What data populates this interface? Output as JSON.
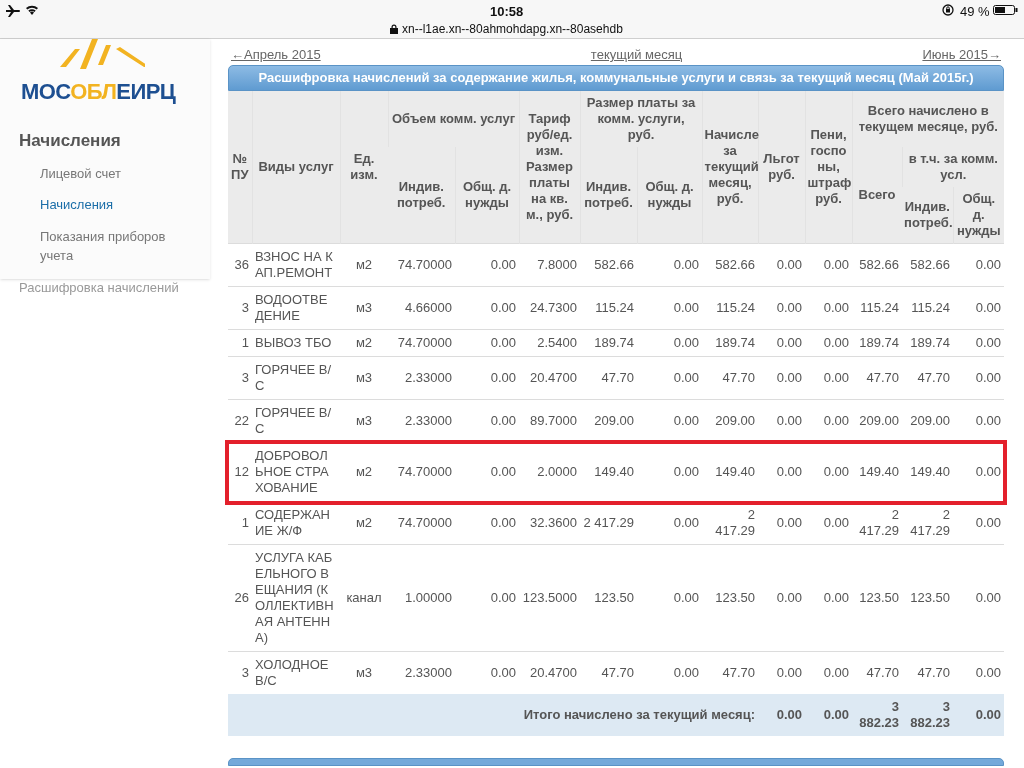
{
  "status_bar": {
    "time": "10:58",
    "url": "xn--l1ae.xn--80ahmohdapg.xn--80asehdb",
    "battery": "49 %"
  },
  "logo": {
    "parts": [
      {
        "text": "МОС",
        "color": "#1d4f91"
      },
      {
        "text": "ОБЛ",
        "color": "#f2b321"
      },
      {
        "text": "ЕИРЦ",
        "color": "#1d4f91"
      }
    ]
  },
  "sidebar": {
    "heading": "Начисления",
    "items": [
      {
        "label": "Лицевой счет",
        "selected": false
      },
      {
        "label": "Начисления",
        "selected": true
      },
      {
        "label": "Показания приборов учета",
        "selected": false
      }
    ],
    "footer_link": "Расшифровка начислений"
  },
  "nav": {
    "prev": "←Апрель 2015",
    "current": "текущий месяц",
    "next": "Июнь 2015→"
  },
  "table": {
    "title": "Расшифровка начислений за содержание жилья, коммунальные услуги и связь за текущий месяц (Май 2015г.)",
    "columns": [
      {
        "label": "№ ПУ"
      },
      {
        "label": "Виды услуг"
      },
      {
        "label": "Ед. изм."
      },
      {
        "label": "Объем комм. услуг",
        "colspan": 2,
        "children": [
          {
            "label": "Индив. потреб."
          },
          {
            "label": "Общ. д. нужды"
          }
        ]
      },
      {
        "label": "Тариф руб/ед. изм. Размер платы на кв. м., руб."
      },
      {
        "label": "Размер платы за комм. услуги, руб.",
        "colspan": 2,
        "children": [
          {
            "label": "Индив. потреб."
          },
          {
            "label": "Общ. д. нужды"
          }
        ]
      },
      {
        "label": "Начисле за текущий месяц, руб."
      },
      {
        "label": "Льгот руб."
      },
      {
        "label": "Пени, госпо ны, штраф руб."
      },
      {
        "label": "Всего начислено в текущем месяце, руб.",
        "colspan": 3,
        "children": [
          {
            "label": "Всего"
          },
          {
            "label": "в т.ч. за комм. усл.",
            "colspan": 2,
            "children": [
              {
                "label": "Индив. потреб."
              },
              {
                "label": "Общ. д. нужды"
              }
            ]
          }
        ]
      }
    ],
    "rows": [
      {
        "highlighted": false,
        "cells": [
          "36",
          "ВЗНОС НА КАП.РЕМОНТ",
          "м2",
          "74.70000",
          "0.00",
          "7.8000",
          "582.66",
          "0.00",
          "582.66",
          "0.00",
          "0.00",
          "582.66",
          "582.66",
          "0.00"
        ]
      },
      {
        "highlighted": false,
        "cells": [
          "3",
          "ВОДООТВЕДЕНИЕ",
          "м3",
          "4.66000",
          "0.00",
          "24.7300",
          "115.24",
          "0.00",
          "115.24",
          "0.00",
          "0.00",
          "115.24",
          "115.24",
          "0.00"
        ]
      },
      {
        "highlighted": false,
        "cells": [
          "1",
          "ВЫВОЗ ТБО",
          "м2",
          "74.70000",
          "0.00",
          "2.5400",
          "189.74",
          "0.00",
          "189.74",
          "0.00",
          "0.00",
          "189.74",
          "189.74",
          "0.00"
        ]
      },
      {
        "highlighted": false,
        "cells": [
          "3",
          "ГОРЯЧЕЕ В/С",
          "м3",
          "2.33000",
          "0.00",
          "20.4700",
          "47.70",
          "0.00",
          "47.70",
          "0.00",
          "0.00",
          "47.70",
          "47.70",
          "0.00"
        ]
      },
      {
        "highlighted": false,
        "cells": [
          "22",
          "ГОРЯЧЕЕ В/С",
          "м3",
          "2.33000",
          "0.00",
          "89.7000",
          "209.00",
          "0.00",
          "209.00",
          "0.00",
          "0.00",
          "209.00",
          "209.00",
          "0.00"
        ]
      },
      {
        "highlighted": true,
        "cells": [
          "12",
          "ДОБРОВОЛЬНОЕ СТРАХОВАНИЕ",
          "м2",
          "74.70000",
          "0.00",
          "2.0000",
          "149.40",
          "0.00",
          "149.40",
          "0.00",
          "0.00",
          "149.40",
          "149.40",
          "0.00"
        ]
      },
      {
        "highlighted": false,
        "cells": [
          "1",
          "СОДЕРЖАНИЕ Ж/Ф",
          "м2",
          "74.70000",
          "0.00",
          "32.3600",
          "2 417.29",
          "0.00",
          "2 417.29",
          "0.00",
          "0.00",
          "2 417.29",
          "2 417.29",
          "0.00"
        ]
      },
      {
        "highlighted": false,
        "cells": [
          "26",
          "УСЛУГА КАБЕЛЬНОГО ВЕЩАНИЯ (КОЛЛЕКТИВНАЯ АНТЕННА)",
          "канал",
          "1.00000",
          "0.00",
          "123.5000",
          "123.50",
          "0.00",
          "123.50",
          "0.00",
          "0.00",
          "123.50",
          "123.50",
          "0.00"
        ]
      },
      {
        "highlighted": false,
        "cells": [
          "3",
          "ХОЛОДНОЕ В/С",
          "м3",
          "2.33000",
          "0.00",
          "20.4700",
          "47.70",
          "0.00",
          "47.70",
          "0.00",
          "0.00",
          "47.70",
          "47.70",
          "0.00"
        ]
      }
    ],
    "total": {
      "label": "Итого начислено за текущий месяц:",
      "values": [
        "0.00",
        "0.00",
        "3 882.23",
        "3 882.23",
        "0.00"
      ]
    }
  }
}
